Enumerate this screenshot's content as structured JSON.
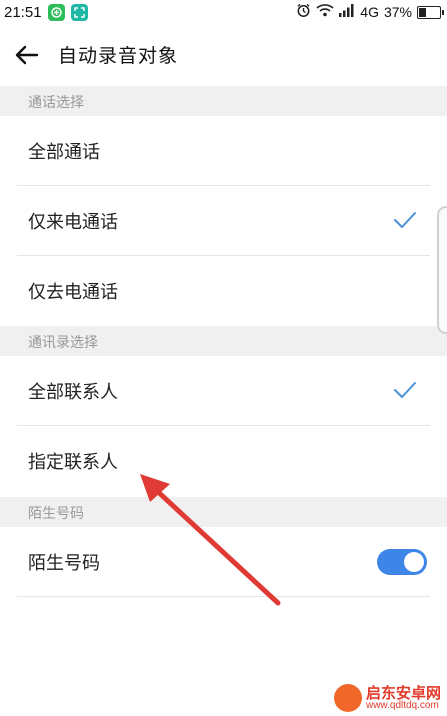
{
  "status": {
    "time": "21:51",
    "network": "4G",
    "battery": "37%",
    "battery_level": 0.37
  },
  "header": {
    "title": "自动录音对象"
  },
  "sections": [
    {
      "title": "通话选择",
      "items": [
        {
          "label": "全部通话",
          "checked": false
        },
        {
          "label": "仅来电通话",
          "checked": true
        },
        {
          "label": "仅去电通话",
          "checked": false
        }
      ]
    },
    {
      "title": "通讯录选择",
      "items": [
        {
          "label": "全部联系人",
          "checked": true
        },
        {
          "label": "指定联系人",
          "checked": false
        }
      ]
    },
    {
      "title": "陌生号码",
      "items": [
        {
          "label": "陌生号码",
          "toggle": true
        }
      ]
    }
  ],
  "colors": {
    "accent": "#3d86e8",
    "check": "#4a90d9",
    "section_bg": "#f0f0f0",
    "arrow": "#e03a35"
  },
  "watermark": {
    "name": "启东安卓网",
    "url": "www.qdltdq.com"
  }
}
